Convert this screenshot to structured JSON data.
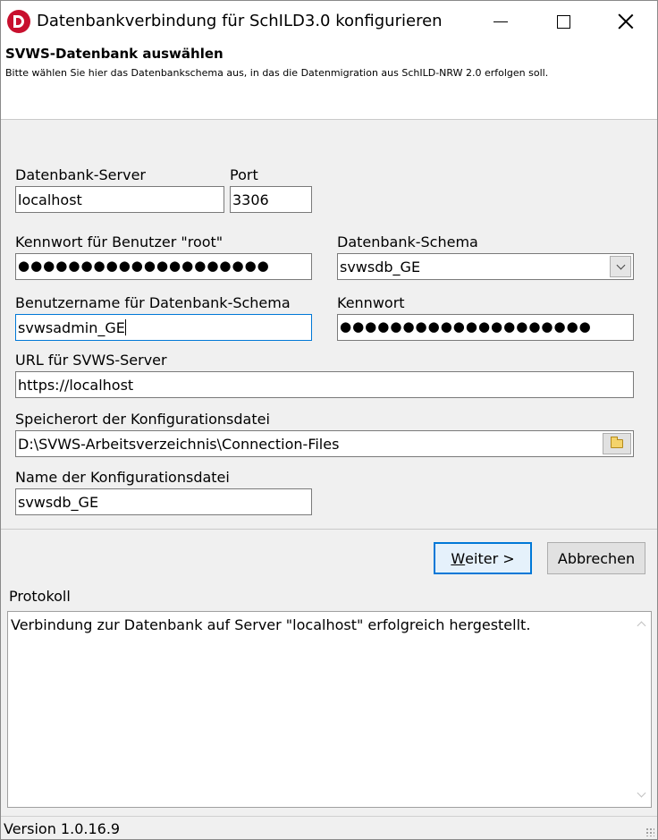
{
  "window": {
    "title": "Datenbankverbindung für SchILD3.0 konfigurieren"
  },
  "header": {
    "title": "SVWS-Datenbank auswählen",
    "description": "Bitte wählen Sie hier das Datenbankschema aus, in das die Datenmigration aus SchILD-NRW 2.0 erfolgen soll."
  },
  "form": {
    "server_label": "Datenbank-Server",
    "server_value": "localhost",
    "port_label": "Port",
    "port_value": "3306",
    "root_pw_label": "Kennwort für Benutzer \"root\"",
    "root_pw_mask": "●●●●●●●●●●●●●●●●●●●●",
    "schema_label": "Datenbank-Schema",
    "schema_value": "svwsdb_GE",
    "user_label": "Benutzername für Datenbank-Schema",
    "user_value": "svwsadmin_GE",
    "pw_label": "Kennwort",
    "pw_mask": "●●●●●●●●●●●●●●●●●●●●",
    "url_label": "URL für SVWS-Server",
    "url_value": "https://localhost",
    "location_label": "Speicherort der Konfigurationsdatei",
    "location_value": "D:\\SVWS-Arbeitsverzeichnis\\Connection-Files",
    "filename_label": "Name der Konfigurationsdatei",
    "filename_value": "svwsdb_GE"
  },
  "buttons": {
    "next_mnemonic": "W",
    "next_rest": "eiter >",
    "cancel": "Abbrechen"
  },
  "log": {
    "label": "Protokoll",
    "text": "Verbindung zur Datenbank auf Server \"localhost\" erfolgreich hergestellt."
  },
  "status": {
    "version": "Version 1.0.16.9"
  },
  "icons": {
    "app": "schild-logo-icon",
    "minimize": "minimize-icon",
    "maximize": "maximize-icon",
    "close": "close-icon",
    "dropdown": "chevron-down-icon",
    "browse": "folder-icon"
  },
  "colors": {
    "accent": "#0078d7",
    "app_icon": "#c8102e",
    "dialog_bg": "#f0f0f0"
  }
}
